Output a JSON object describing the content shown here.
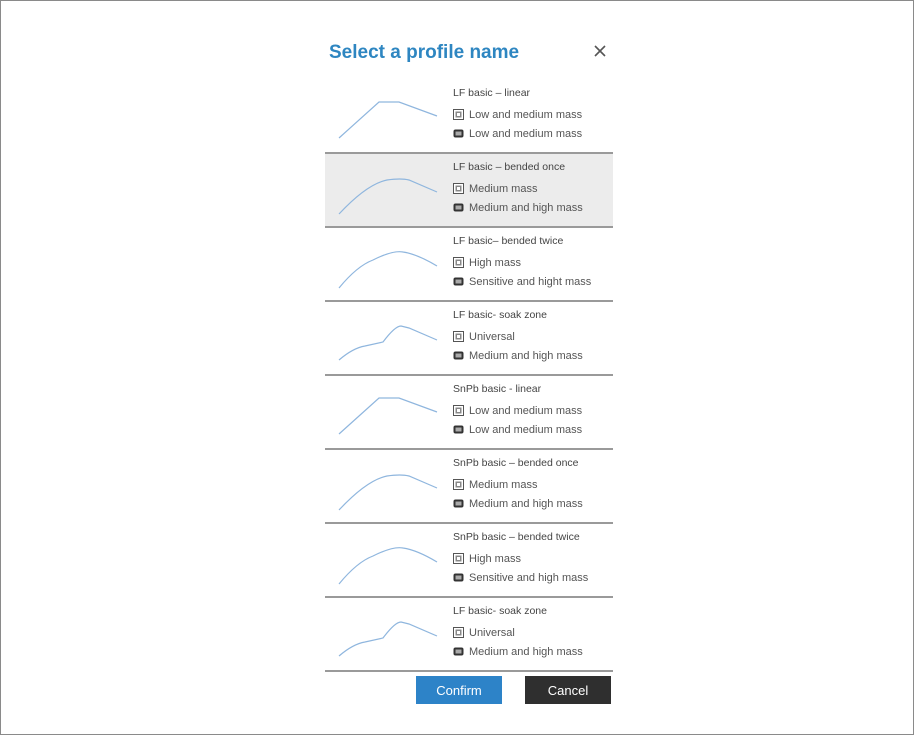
{
  "dialog": {
    "title": "Select a profile name",
    "close_icon": "close-icon",
    "confirm_label": "Confirm",
    "cancel_label": "Cancel"
  },
  "colors": {
    "title": "#2e86c1",
    "curve": "#8fb6de",
    "confirm": "#2d83c8",
    "cancel": "#2f2f2f",
    "selected_row": "#ececec"
  },
  "profiles": [
    {
      "name": "LF basic – linear",
      "line1": "Low and medium mass",
      "line2": "Low and medium mass",
      "curve": "linear"
    },
    {
      "name": "LF basic – bended once",
      "line1": "Medium mass",
      "line2": "Medium and high mass",
      "curve": "bended-once",
      "selected": true
    },
    {
      "name": "LF basic– bended twice",
      "line1": "High mass",
      "line2": "Sensitive and hight mass",
      "curve": "bended-twice"
    },
    {
      "name": "LF basic- soak zone",
      "line1": "Universal",
      "line2": "Medium and high mass",
      "curve": "soak-zone"
    },
    {
      "name": "SnPb basic - linear",
      "line1": "Low and medium mass",
      "line2": "Low and medium mass",
      "curve": "linear"
    },
    {
      "name": "SnPb basic – bended once",
      "line1": "Medium mass",
      "line2": "Medium and high mass",
      "curve": "bended-once"
    },
    {
      "name": "SnPb basic – bended twice",
      "line1": "High mass",
      "line2": "Sensitive and high mass",
      "curve": "bended-twice"
    },
    {
      "name": "LF basic- soak zone",
      "line1": "Universal",
      "line2": "Medium and high mass",
      "curve": "soak-zone"
    }
  ]
}
